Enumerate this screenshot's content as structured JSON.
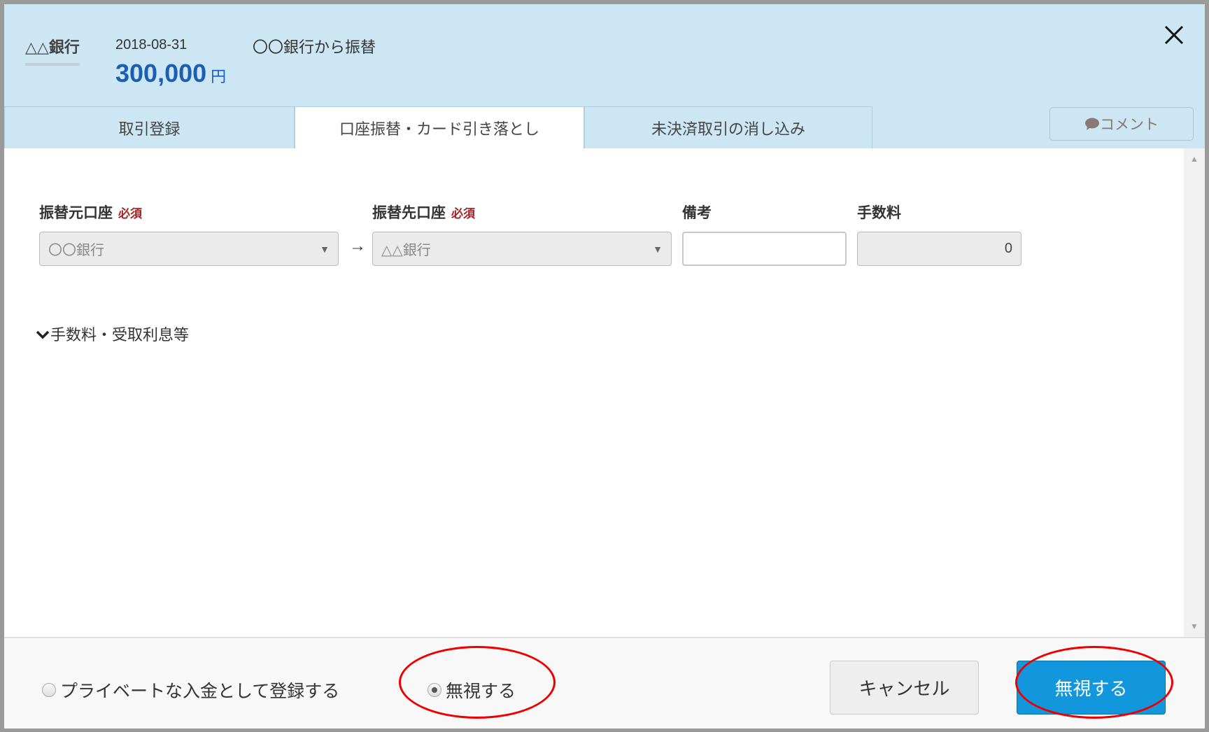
{
  "header": {
    "bank_name": "△△銀行",
    "date": "2018-08-31",
    "amount": "300,000",
    "currency": "円",
    "description": "〇〇銀行から振替"
  },
  "tabs": [
    {
      "label": "取引登録",
      "active": false
    },
    {
      "label": "口座振替・カード引き落とし",
      "active": true
    },
    {
      "label": "未決済取引の消し込み",
      "active": false
    }
  ],
  "comment_button": "コメント",
  "form": {
    "from_label": "振替元口座",
    "to_label": "振替先口座",
    "required": "必須",
    "memo_label": "備考",
    "fee_label": "手数料",
    "from_value": "〇〇銀行",
    "to_value": "△△銀行",
    "memo_value": "",
    "fee_value": "0",
    "arrow": "→",
    "expander": "手数料・受取利息等"
  },
  "footer": {
    "radio_private": "プライベートな入金として登録する",
    "radio_ignore": "無視する",
    "selected": "radio_ignore",
    "cancel": "キャンセル",
    "ignore_button": "無視する"
  },
  "colors": {
    "header_bg": "#cce6f4",
    "primary": "#1296dc",
    "amount": "#1b5fb0",
    "annotation": "#ee0000"
  }
}
